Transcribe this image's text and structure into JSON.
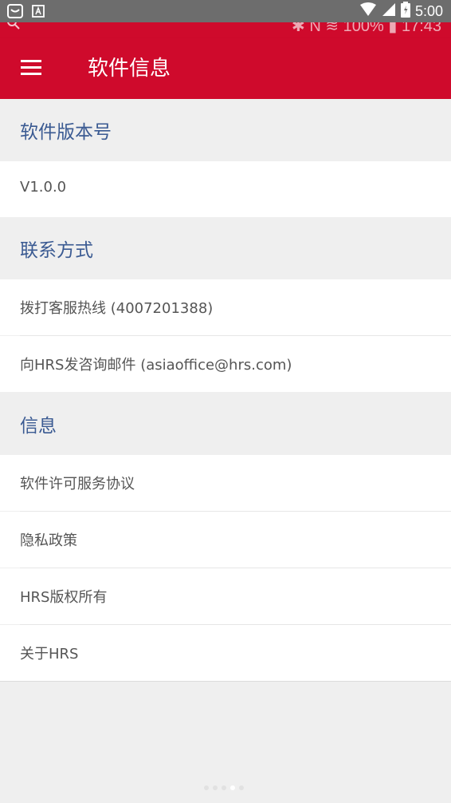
{
  "status_bar": {
    "time": "5:00",
    "icons": [
      "notification-icon",
      "text-icon",
      "wifi-icon",
      "signal-icon",
      "battery-icon"
    ]
  },
  "inner_status": {
    "text": "✱ N  ≋ 100% ▮ 17:43"
  },
  "app_bar": {
    "title": "软件信息",
    "color": "#cf0a2c"
  },
  "sections": {
    "version": {
      "header": "软件版本号",
      "items": [
        "V1.0.0"
      ]
    },
    "contact": {
      "header": "联系方式",
      "items": [
        "拨打客服热线 (4007201388)",
        "向HRS发咨询邮件 (asiaoffice@hrs.com)"
      ]
    },
    "info": {
      "header": "信息",
      "items": [
        "软件许可服务协议",
        "隐私政策",
        "HRS版权所有",
        "关于HRS"
      ]
    }
  },
  "page_indicator": {
    "count": 5,
    "active_index": 3
  }
}
